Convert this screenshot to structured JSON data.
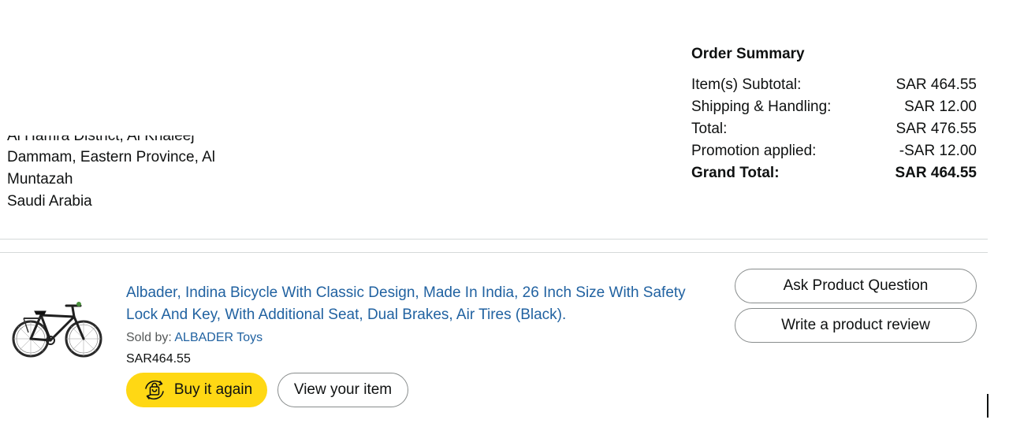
{
  "address": {
    "partial_line": "Al Hamra District, Al Khaleej",
    "line1": "Dammam, Eastern Province, Al",
    "line2": "Muntazah",
    "country": "Saudi Arabia"
  },
  "order_summary": {
    "title": "Order Summary",
    "rows": [
      {
        "label": "Item(s) Subtotal:",
        "value": "SAR 464.55"
      },
      {
        "label": "Shipping & Handling:",
        "value": "SAR 12.00"
      },
      {
        "label": "Total:",
        "value": "SAR 476.55"
      },
      {
        "label": "Promotion applied:",
        "value": "-SAR 12.00"
      }
    ],
    "grand_total": {
      "label": "Grand Total:",
      "value": "SAR 464.55"
    }
  },
  "item": {
    "image_icon": "bicycle-image",
    "title": "Albader, Indina Bicycle With Classic Design, Made In India, 26 Inch Size With Safety Lock And Key, With Additional Seat, Dual Brakes, Air Tires (Black).",
    "sold_by_label": "Sold by:",
    "seller": "ALBADER Toys",
    "price": "SAR464.55",
    "buy_again_label": "Buy it again",
    "buy_again_icon": "reorder-bag-icon",
    "view_item_label": "View your item"
  },
  "side_actions": {
    "ask_question_label": "Ask Product Question",
    "write_review_label": "Write a product review"
  },
  "colors": {
    "link": "#2162a1",
    "buy_button": "#ffd814",
    "button_border": "#888c8c",
    "divider": "#d5d9d9"
  }
}
